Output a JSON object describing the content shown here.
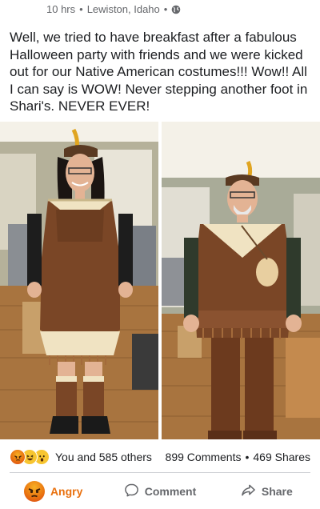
{
  "post": {
    "time": "10 hrs",
    "location": "Lewiston, Idaho",
    "separator": "•",
    "text": "Well, we tried to have breakfast after a fabulous Halloween party with friends and we were kicked out for our Native American costumes!!! Wow!! All I can say is WOW! Never stepping another foot in Shari's. NEVER EVER!"
  },
  "icons": {
    "privacy": "globe-icon",
    "reactions": [
      "angry-icon",
      "haha-icon",
      "wow-icon"
    ],
    "comment": "comment-icon",
    "share": "share-icon"
  },
  "stats": {
    "reactions_text": "You and 585 others",
    "comments": "899 Comments",
    "bullet": "•",
    "shares": "469 Shares"
  },
  "actions": {
    "react": "Angry",
    "comment": "Comment",
    "share": "Share"
  },
  "colors": {
    "angry": "#e9710f",
    "muted": "#65676b",
    "costume_brown": "#7a4626",
    "costume_cream": "#f0e3c2"
  }
}
